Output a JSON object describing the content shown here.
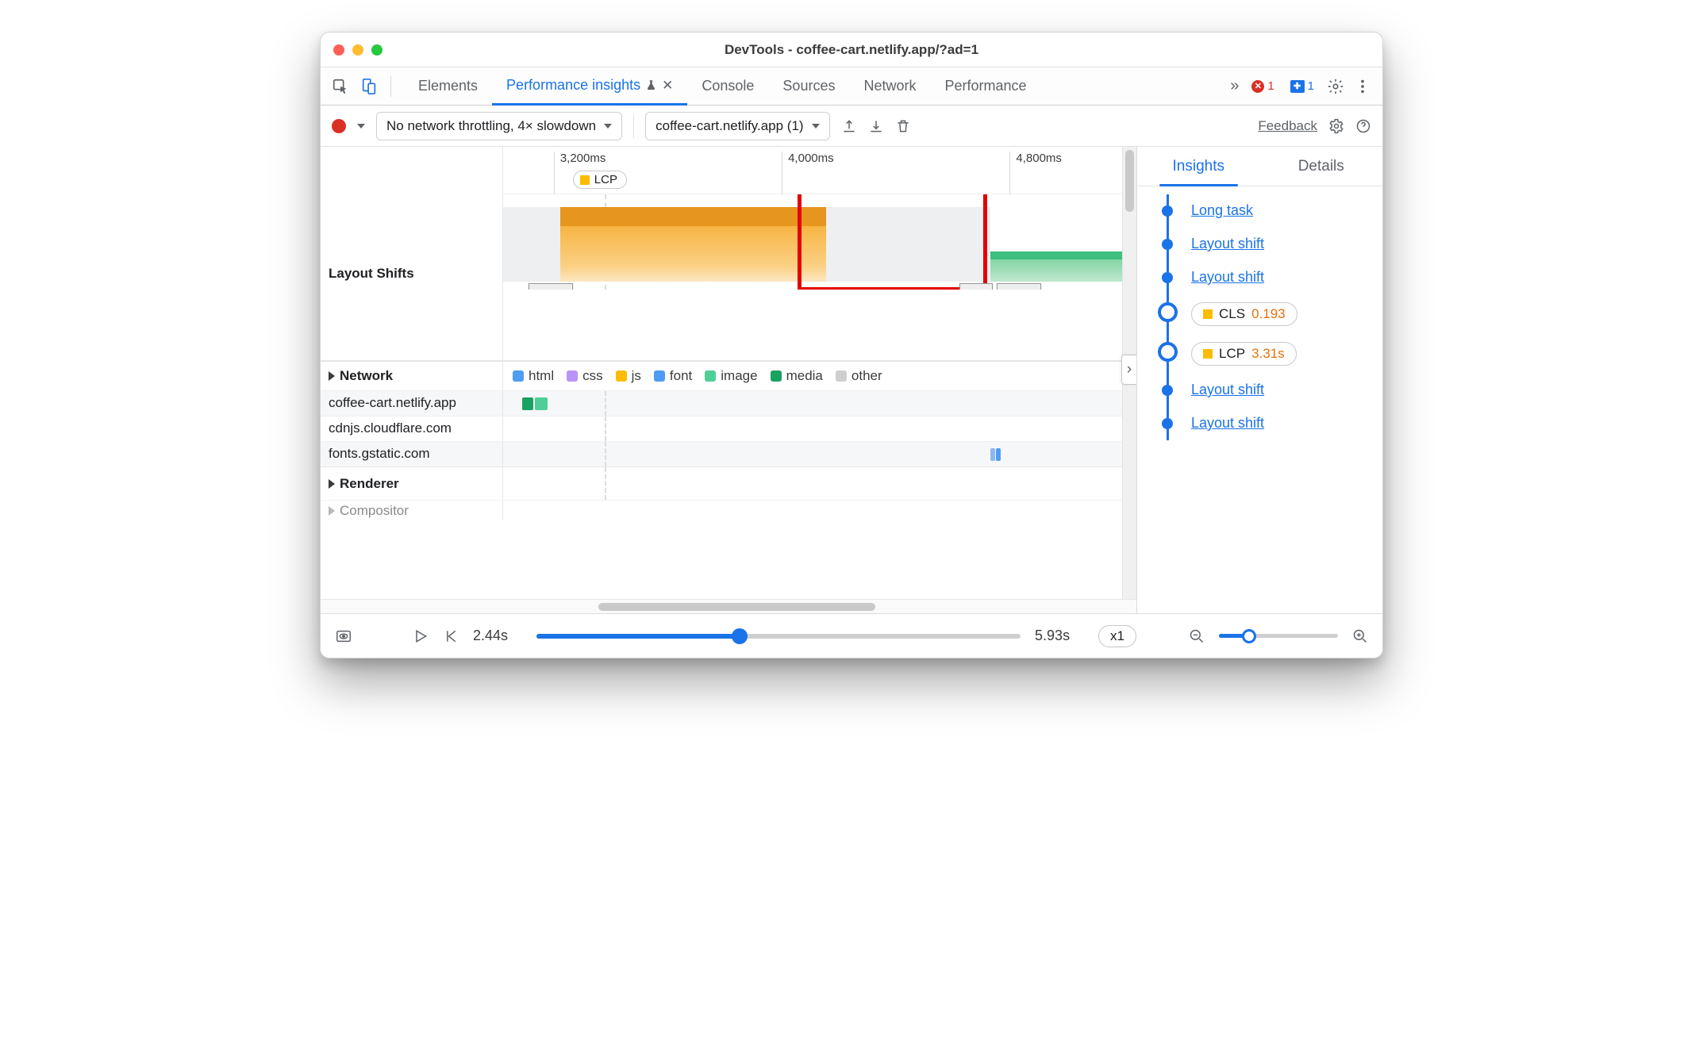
{
  "window": {
    "title": "DevTools - coffee-cart.netlify.app/?ad=1"
  },
  "tabs": [
    "Elements",
    "Performance insights",
    "Console",
    "Sources",
    "Network",
    "Performance"
  ],
  "status": {
    "errors": "1",
    "messages": "1"
  },
  "toolbar": {
    "throttling": "No network throttling, 4× slowdown",
    "recording": "coffee-cart.netlify.app (1)",
    "feedback": "Feedback"
  },
  "timeline": {
    "ticks": [
      "3,200ms",
      "4,000ms",
      "4,800ms"
    ],
    "lcp_chip": "LCP",
    "rows": {
      "layout_shifts": "Layout Shifts",
      "network": "Network",
      "renderer": "Renderer",
      "compositor": "Compositor"
    }
  },
  "legend": [
    "html",
    "css",
    "js",
    "font",
    "image",
    "media",
    "other"
  ],
  "network_hosts": [
    "coffee-cart.netlify.app",
    "cdnjs.cloudflare.com",
    "fonts.gstatic.com"
  ],
  "panel": {
    "tabs": [
      "Insights",
      "Details"
    ]
  },
  "insights": [
    {
      "type": "link",
      "label": "Long task"
    },
    {
      "type": "link",
      "label": "Layout shift"
    },
    {
      "type": "link",
      "label": "Layout shift"
    },
    {
      "type": "metric",
      "label": "CLS",
      "value": "0.193"
    },
    {
      "type": "metric",
      "label": "LCP",
      "value": "3.31s"
    },
    {
      "type": "link",
      "label": "Layout shift"
    },
    {
      "type": "link",
      "label": "Layout shift"
    }
  ],
  "playback": {
    "start": "2.44s",
    "end": "5.93s",
    "speed": "x1"
  },
  "colors": {
    "accent": "#1a73e8",
    "warn": "#e8710a",
    "lcp_swatch": "#fbbc04",
    "error": "#d93025"
  }
}
